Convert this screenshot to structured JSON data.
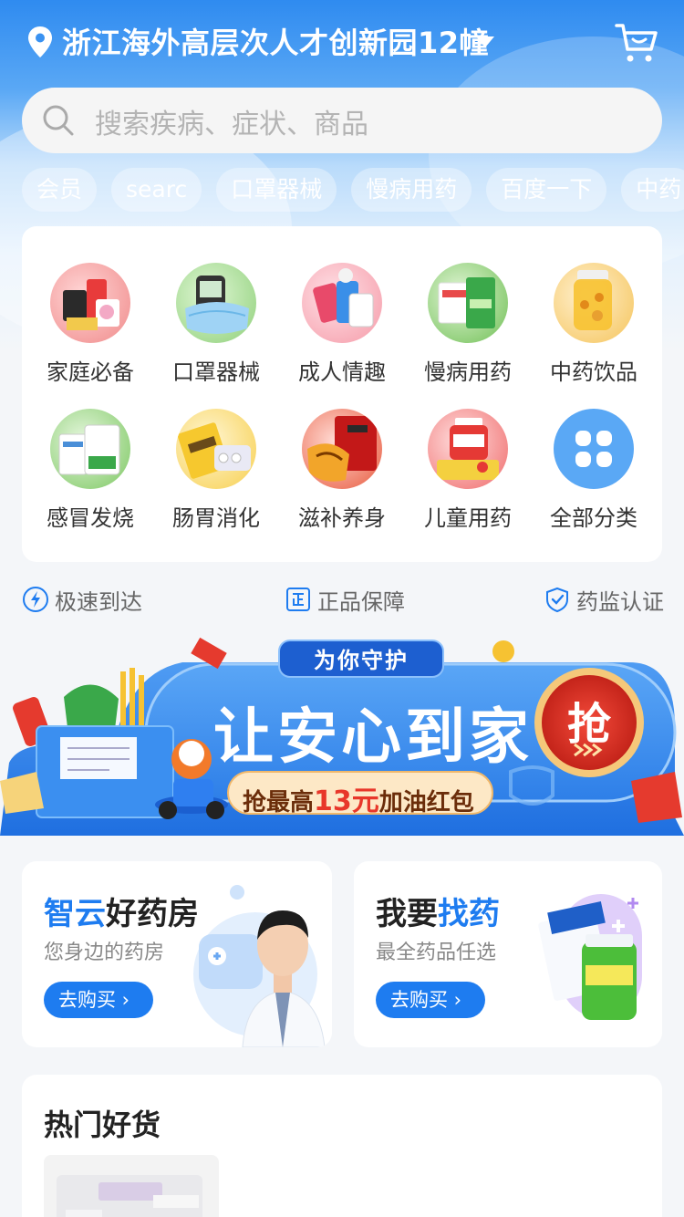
{
  "header": {
    "location": "浙江海外高层次人才创新园12幢"
  },
  "search": {
    "placeholder": "搜索疾病、症状、商品"
  },
  "quick_tags": [
    "会员",
    "searc",
    "口罩器械",
    "慢病用药",
    "百度一下",
    "中药"
  ],
  "categories": [
    {
      "label": "家庭必备",
      "icon": "family-kit-icon"
    },
    {
      "label": "口罩器械",
      "icon": "mask-icon"
    },
    {
      "label": "成人情趣",
      "icon": "adult-icon"
    },
    {
      "label": "慢病用药",
      "icon": "chronic-medicine-icon"
    },
    {
      "label": "中药饮品",
      "icon": "herbal-icon"
    },
    {
      "label": "感冒发烧",
      "icon": "cold-medicine-icon"
    },
    {
      "label": "肠胃消化",
      "icon": "digestion-icon"
    },
    {
      "label": "滋补养身",
      "icon": "tonic-icon"
    },
    {
      "label": "儿童用药",
      "icon": "children-medicine-icon"
    },
    {
      "label": "全部分类",
      "icon": "all-categories-icon"
    }
  ],
  "guarantees": [
    {
      "label": "极速到达",
      "icon": "lightning-icon"
    },
    {
      "label": "正品保障",
      "icon": "authentic-icon"
    },
    {
      "label": "药监认证",
      "icon": "shield-check-icon"
    }
  ],
  "banner": {
    "tag": "为你守护",
    "headline": "让安心到家",
    "sub_prefix": "抢最高",
    "sub_amount": "13元",
    "sub_suffix": "加油红包",
    "grab_label": "抢"
  },
  "promos": [
    {
      "title_hl": "智云",
      "title_rest": "好药房",
      "subtitle": "您身边的药房",
      "button": "去购买 ›"
    },
    {
      "title_plain": "我要",
      "title_hl": "找药",
      "subtitle": "最全药品任选",
      "button": "去购买 ›"
    }
  ],
  "hot": {
    "title": "热门好货"
  },
  "colors": {
    "brand_blue": "#1e7cf0",
    "header_blue": "#2f8bf0",
    "banner_red": "#e8372a"
  }
}
